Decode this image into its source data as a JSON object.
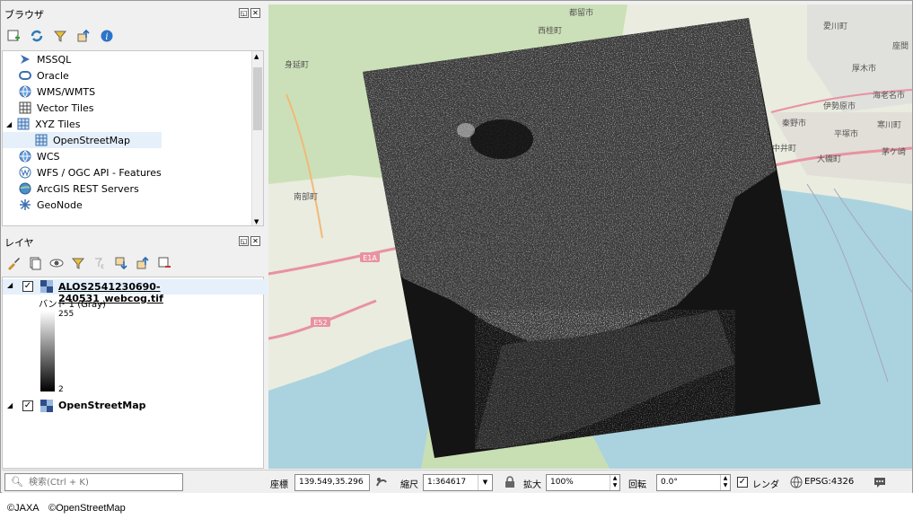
{
  "browser": {
    "title": "ブラウザ",
    "items": [
      {
        "label": "MSSQL"
      },
      {
        "label": "Oracle"
      },
      {
        "label": "WMS/WMTS"
      },
      {
        "label": "Vector Tiles"
      },
      {
        "label": "XYZ Tiles"
      },
      {
        "label": "OpenStreetMap"
      },
      {
        "label": "WCS"
      },
      {
        "label": "WFS / OGC API - Features"
      },
      {
        "label": "ArcGIS REST Servers"
      },
      {
        "label": "GeoNode"
      }
    ]
  },
  "layers": {
    "title": "レイヤ",
    "items": [
      {
        "label": "ALOS2541230690-240531_webcog.tif"
      },
      {
        "label": "OpenStreetMap"
      }
    ],
    "legend": {
      "band": "バンド 1 (Gray)",
      "max": "255",
      "min": "2"
    }
  },
  "search": {
    "placeholder": "検索(Ctrl + K)"
  },
  "status": {
    "coord_label": "座標",
    "coord_value": "139.549,35.296",
    "scale_label": "縮尺",
    "scale_value": "1:364617",
    "magnify_label": "拡大",
    "magnify_value": "100%",
    "rotation_label": "回転",
    "rotation_value": "0.0°",
    "render_label": "レンダ",
    "crs": "EPSG:4326"
  },
  "map": {
    "labels": [
      "都留市",
      "西桂町",
      "身延町",
      "南部町",
      "愛川町",
      "座間",
      "厚木市",
      "海老名市",
      "伊勢原市",
      "秦野市",
      "平塚市",
      "中井町",
      "寒川町",
      "茅ケ崎",
      "大磯町",
      "E1A",
      "E52"
    ]
  },
  "credits": "©JAXA　©OpenStreetMap",
  "colors": {
    "sea": "#aad3df",
    "land": "#e9ecdf",
    "forest": "#c8dfb4",
    "road_major": "#e892a2",
    "raster_bg": "#151515"
  }
}
